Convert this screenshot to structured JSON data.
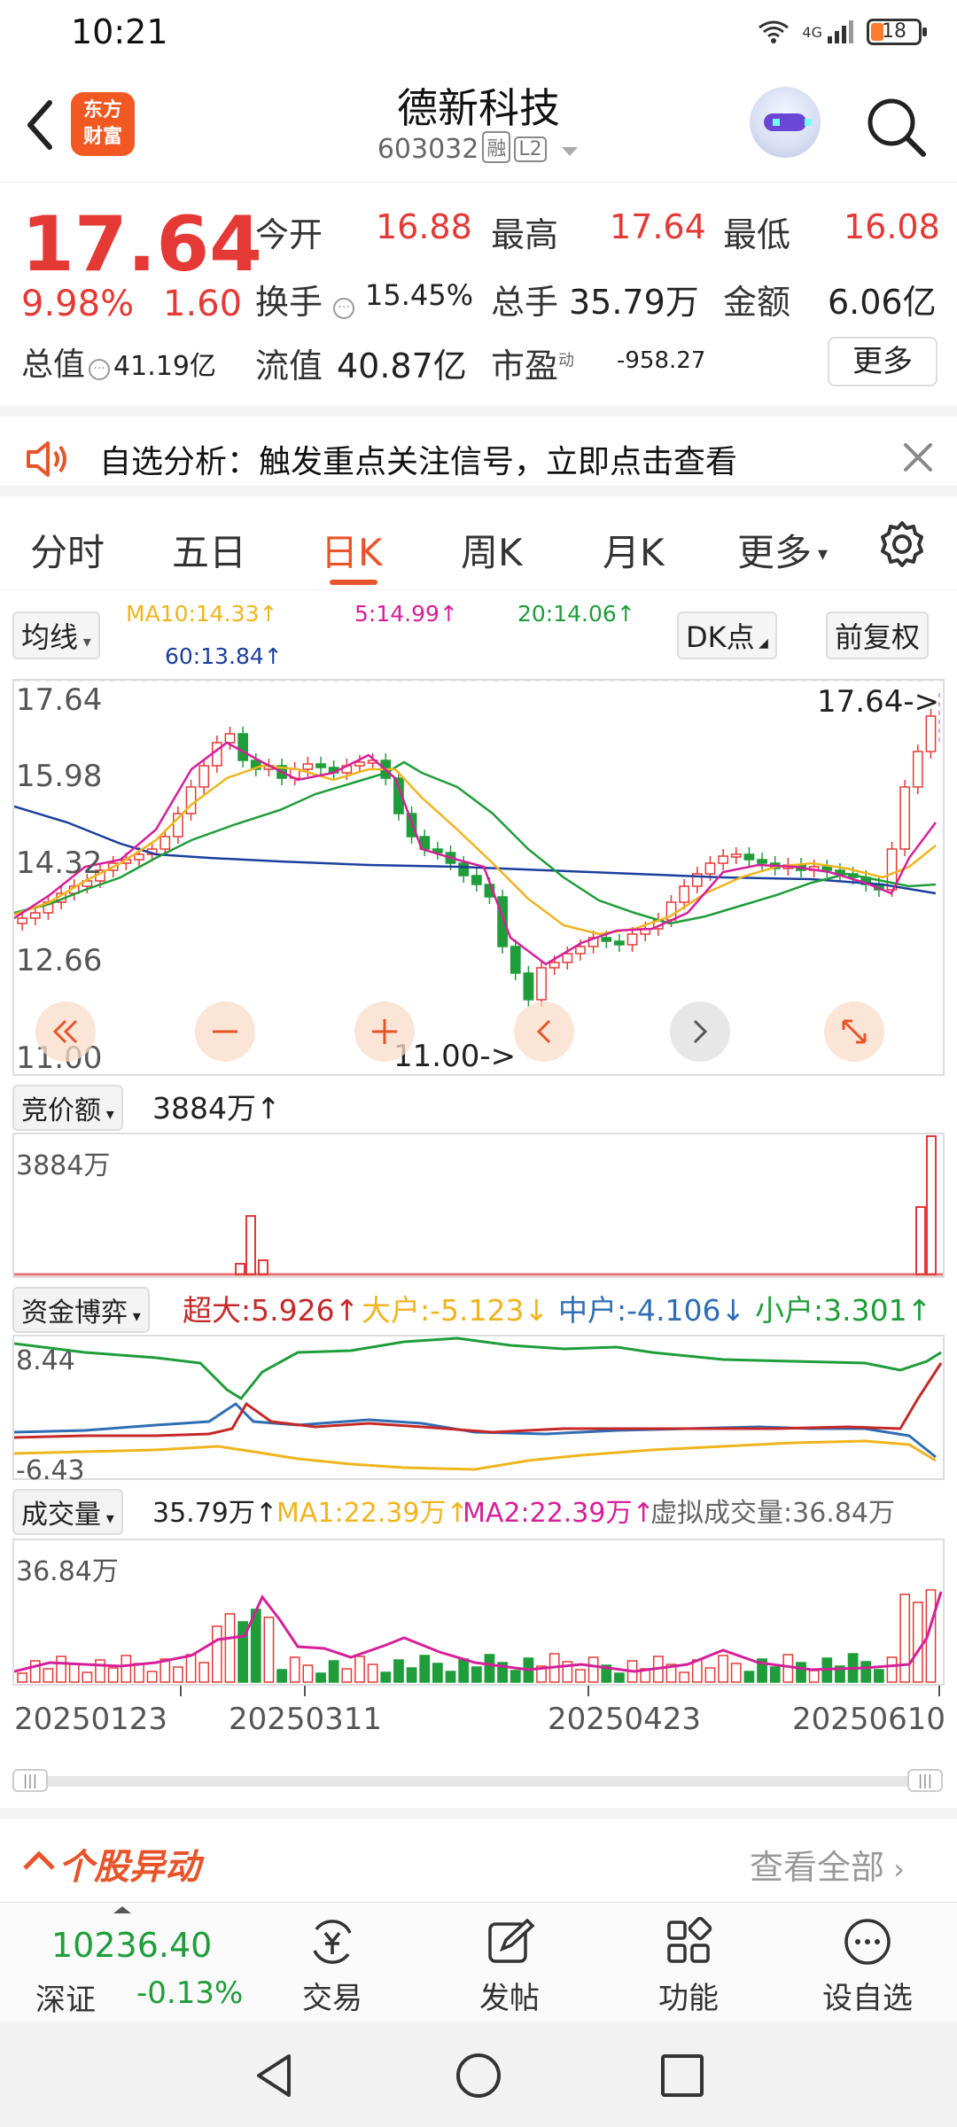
{
  "status_bar": {
    "time": "10:21",
    "network": "4G",
    "battery": "18"
  },
  "header": {
    "stock_name": "德新科技",
    "stock_code": "603032",
    "tags": [
      "融",
      "L2"
    ],
    "brand": [
      "东方",
      "财富"
    ]
  },
  "quote": {
    "price": "17.64",
    "change_pct": "9.98%",
    "change": "1.60",
    "open_label": "今开",
    "open": "16.88",
    "high_label": "最高",
    "high": "17.64",
    "low_label": "最低",
    "low": "16.08",
    "turnover_label": "换手",
    "turnover": "15.45%",
    "volume_label": "总手",
    "volume": "35.79万",
    "amount_label": "金额",
    "amount": "6.06亿",
    "mktcap_label": "总值",
    "mktcap": "41.19亿",
    "float_label": "流值",
    "float_cap": "40.87亿",
    "pe_label": "市盈",
    "pe_sup": "动",
    "pe": "-958.27",
    "more": "更多"
  },
  "banner": {
    "text": "自选分析：触发重点关注信号，立即点击查看"
  },
  "tabs": {
    "items": [
      "分时",
      "五日",
      "日K",
      "周K",
      "月K",
      "更多"
    ],
    "active": "日K"
  },
  "chart_toolbar": {
    "ma_select": "均线",
    "ma10": "MA10:14.33↑",
    "ma5": "5:14.99↑",
    "ma20": "20:14.06↑",
    "ma60": "60:13.84↑",
    "dk": "DK点",
    "adjust": "前复权"
  },
  "kline": {
    "y_labels": [
      "17.64",
      "15.98",
      "14.32",
      "12.66",
      "11.00"
    ],
    "high_marker": "17.64->",
    "low_marker": "11.00->"
  },
  "auction": {
    "label": "竞价额",
    "value": "3884万↑",
    "axis_max": "3884万"
  },
  "fund_flow": {
    "label": "资金博弈",
    "super_large": "超大:5.926↑",
    "large": "大户:-5.123↓",
    "medium": "中户:-4.106↓",
    "small": "小户:3.301↑",
    "axis_max": "8.44",
    "axis_min": "-6.43"
  },
  "volume_panel": {
    "label": "成交量",
    "value": "35.79万↑",
    "ma1": "MA1:22.39万↑",
    "ma2": "MA2:22.39万↑",
    "virtual": "虚拟成交量:36.84万",
    "axis_max": "36.84万",
    "dates": [
      "20250123",
      "20250311",
      "20250423",
      "20250610"
    ]
  },
  "movers": {
    "title": "个股异动",
    "link": "查看全部"
  },
  "bottom_nav": {
    "index_value": "10236.40",
    "index_name": "深证",
    "index_change": "-0.13%",
    "items": [
      "交易",
      "发帖",
      "功能",
      "设自选"
    ]
  },
  "colors": {
    "up": "#e53935",
    "down": "#1f9d3a",
    "accent": "#e8542a",
    "ma5": "#d5209a",
    "ma10": "#f0b41e",
    "ma20": "#1f9d3a",
    "ma60": "#1c3f9e"
  }
}
